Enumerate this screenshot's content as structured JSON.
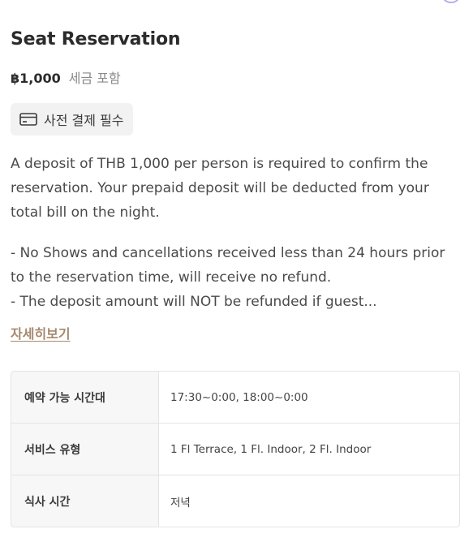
{
  "product": {
    "title": "Seat Reservation",
    "price": "฿1,000",
    "tax_note": "세금 포함",
    "badge_label": "사전 결제 필수",
    "badge_icon": "credit-card-icon"
  },
  "description": {
    "para1": "A deposit of THB 1,000 per person is required to confirm the reservation. Your prepaid deposit will be deducted from your total bill on the night.",
    "para2": "- No Shows and cancellations received less than 24 hours prior to the reservation time, will receive no refund.",
    "para3": "- The deposit amount will NOT be refunded if guest..."
  },
  "read_more_label": "자세히보기",
  "info_table": {
    "rows": [
      {
        "label": "예약 가능 시간대",
        "value": "17:30~0:00, 18:00~0:00"
      },
      {
        "label": "서비스 유형",
        "value": "1 Fl Terrace, 1 Fl. Indoor, 2 Fl. Indoor"
      },
      {
        "label": "식사 시간",
        "value": "저녁"
      }
    ]
  },
  "colors": {
    "link": "#a5896e",
    "badge_bg": "#f2f2f2",
    "table_label_bg": "#f7f7f7"
  }
}
